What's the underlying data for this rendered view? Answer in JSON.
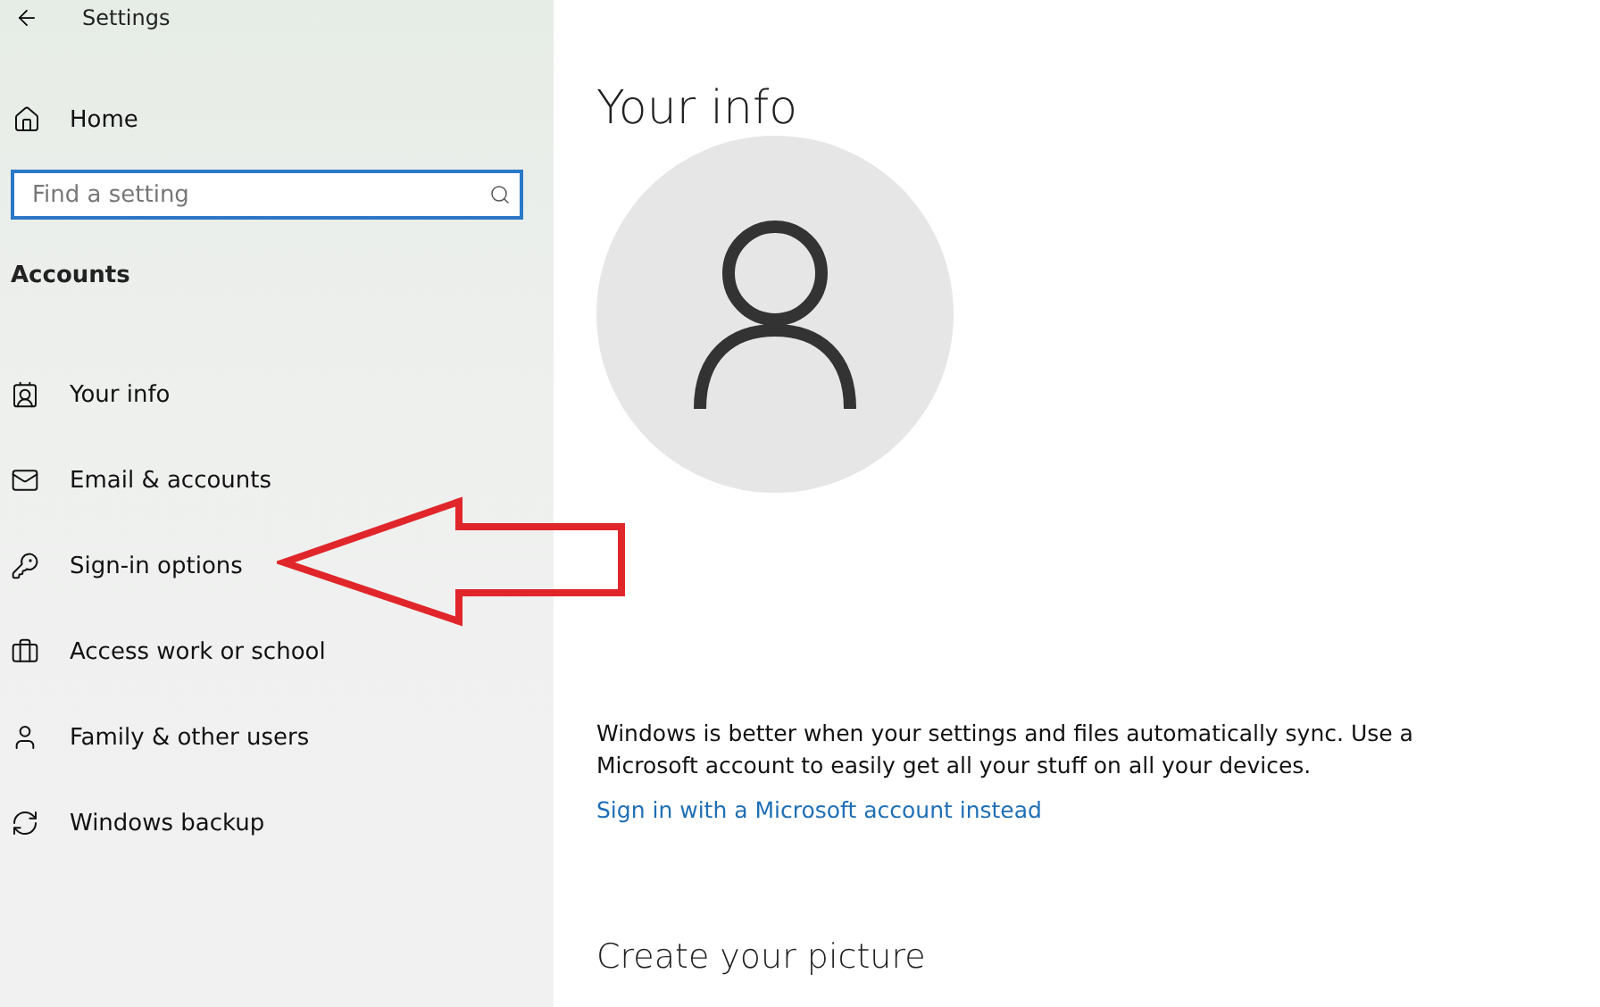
{
  "window": {
    "title": "Settings"
  },
  "sidebar": {
    "home": "Home",
    "search": {
      "placeholder": "Find a setting"
    },
    "section": "Accounts",
    "items": [
      {
        "label": "Your info",
        "kind": "info"
      },
      {
        "label": "Email & accounts",
        "kind": "mail"
      },
      {
        "label": "Sign-in options",
        "kind": "key"
      },
      {
        "label": "Access work or school",
        "kind": "briefcase"
      },
      {
        "label": "Family & other users",
        "kind": "person"
      },
      {
        "label": "Windows backup",
        "kind": "sync"
      }
    ]
  },
  "main": {
    "title": "Your info",
    "sync_text": "Windows is better when your settings and files automatically sync. Use a Microsoft account to easily get all your stuff on all your devices.",
    "link": "Sign in with a Microsoft account instead",
    "next_heading": "Create your picture"
  }
}
